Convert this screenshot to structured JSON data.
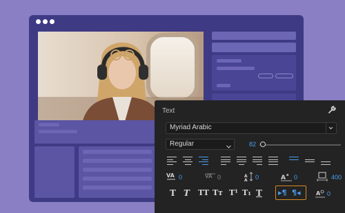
{
  "panel": {
    "title": "Text",
    "font_family": "Myriad Arabic",
    "font_style": "Regular",
    "font_size": "82",
    "font_size_slider_fraction": 0.04,
    "kerning": "0",
    "tracking": "0",
    "leading": "0",
    "baseline_shift": "0",
    "tsume_value": "400",
    "last_value": "0"
  },
  "toolbar": {
    "faux_bold": "T",
    "faux_italic": "T",
    "all_caps": "TT",
    "small_caps": "Tт",
    "superscript": "T¹",
    "subscript": "T₁",
    "underline": "T"
  },
  "colors": {
    "background": "#8a7fc4",
    "window": "#3f3a84",
    "panel": "#232323",
    "accent_blue": "#4a9df0",
    "highlight_orange": "#d68a1f"
  },
  "icons": {
    "wrench": "wrench-icon",
    "ltr": "ltr-paragraph-icon",
    "rtl": "rtl-paragraph-icon"
  }
}
